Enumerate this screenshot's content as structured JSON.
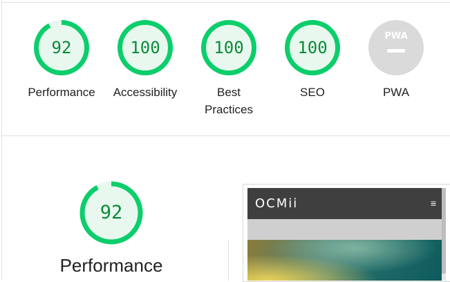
{
  "scores": [
    {
      "label": "Performance",
      "score": "92",
      "fraction": 0.92
    },
    {
      "label": "Accessibility",
      "score": "100",
      "fraction": 1.0
    },
    {
      "label": "Best Practices",
      "score": "100",
      "fraction": 1.0
    },
    {
      "label": "SEO",
      "score": "100",
      "fraction": 1.0
    },
    {
      "label": "PWA",
      "badge": "PWA"
    }
  ],
  "performance_section": {
    "score": "92",
    "fraction": 0.92,
    "label": "Performance"
  },
  "screenshot": {
    "logo": "OCMii",
    "menu_icon": "hamburger-menu-icon"
  },
  "colors": {
    "pass": "#0cce6b",
    "pass_fill": "#e8f8ef",
    "score_text": "#0b8a3a",
    "na_gray": "#d9d9d9"
  }
}
